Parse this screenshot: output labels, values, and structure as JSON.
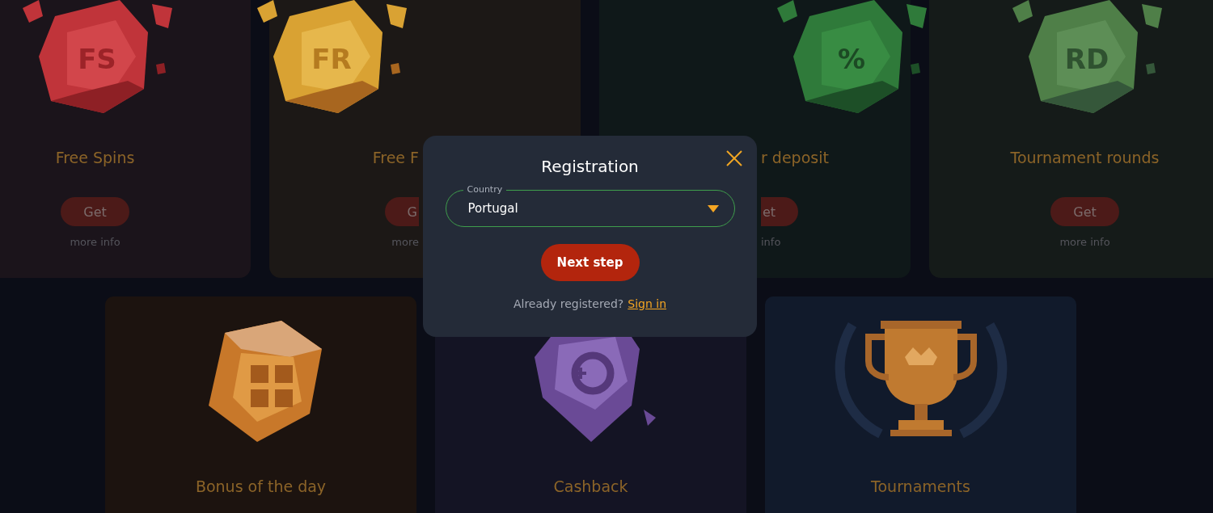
{
  "promotions": [
    {
      "kind": "red",
      "gem_label": "FS",
      "title": "Free Spins",
      "button": "Get",
      "link": "more info"
    },
    {
      "kind": "gold",
      "gem_label": "FR",
      "title": "Free F",
      "button": "G",
      "link": "more"
    },
    {
      "kind": "green",
      "gem_label": "%",
      "title": "r deposit",
      "button": "et",
      "link": "info"
    },
    {
      "kind": "pale-green",
      "gem_label": "RD",
      "title": "Tournament rounds",
      "button": "Get",
      "link": "more info"
    }
  ],
  "features": [
    {
      "kind": "bonus",
      "title": "Bonus of the day"
    },
    {
      "kind": "cashback",
      "title": "Cashback"
    },
    {
      "kind": "trophy",
      "title": "Tournaments"
    }
  ],
  "modal": {
    "title": "Registration",
    "country_field": {
      "label": "Country",
      "value": "Portugal"
    },
    "submit": "Next step",
    "signin_prompt": "Already registered?",
    "signin_link": "Sign in"
  }
}
